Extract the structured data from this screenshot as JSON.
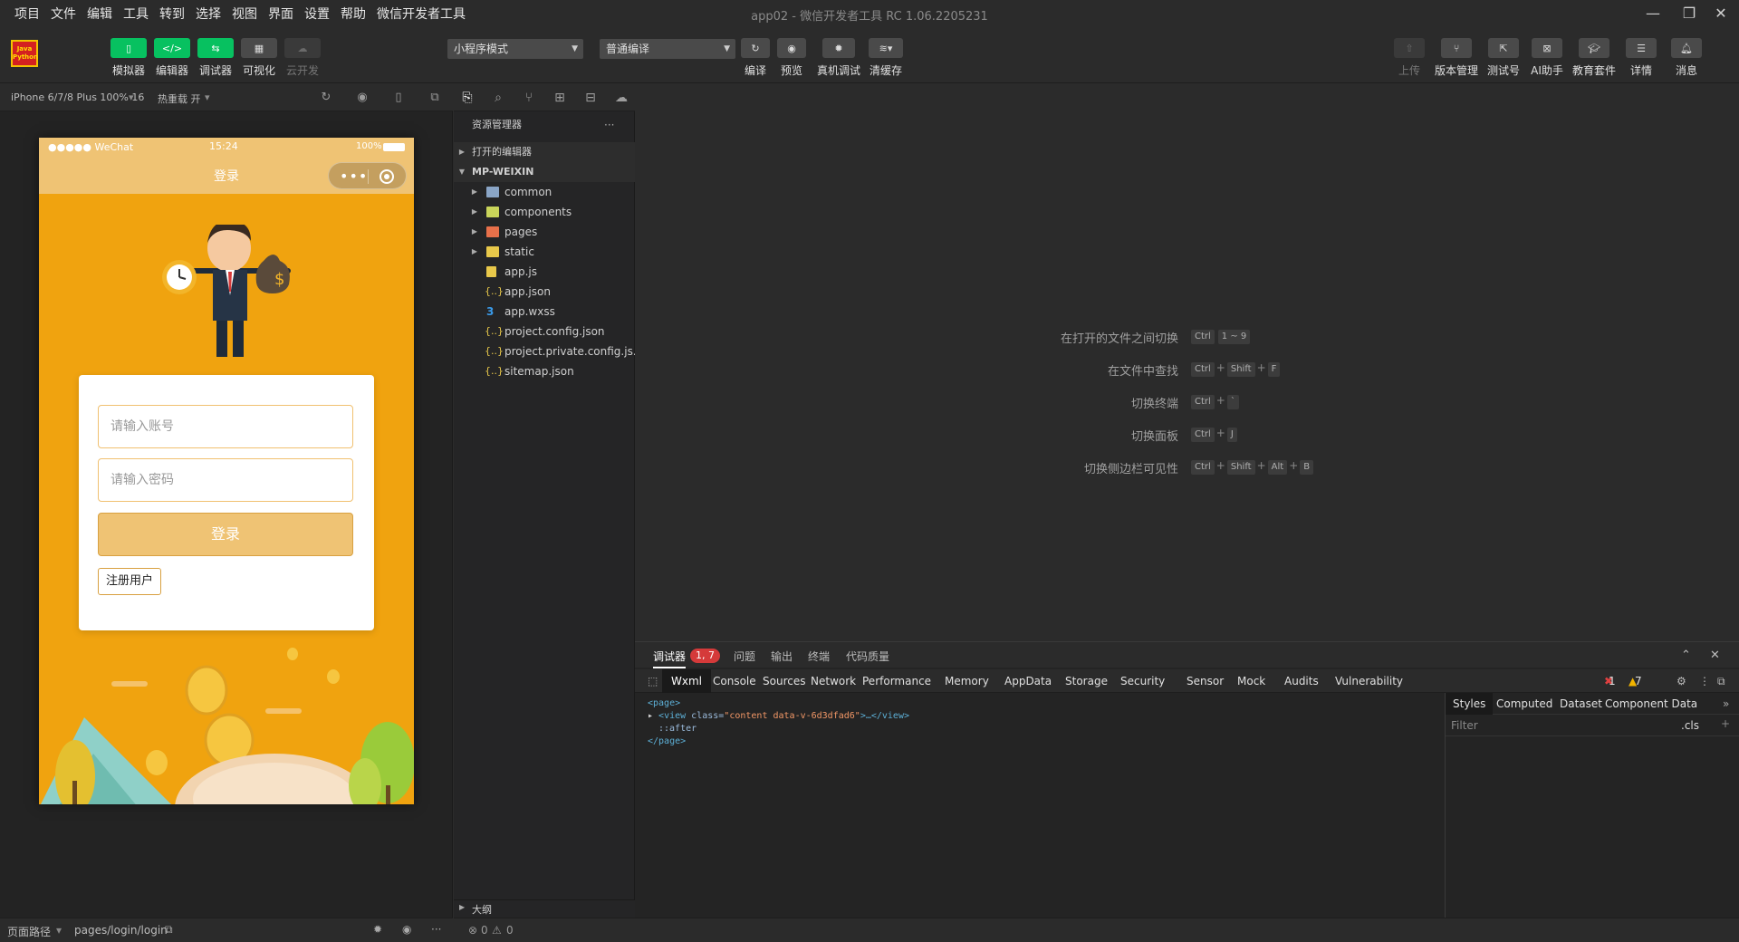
{
  "menu": [
    "项目",
    "文件",
    "编辑",
    "工具",
    "转到",
    "选择",
    "视图",
    "界面",
    "设置",
    "帮助",
    "微信开发者工具"
  ],
  "window_title": "app02 - 微信开发者工具 RC 1.06.2205231",
  "logo_text": [
    "Java",
    "Python"
  ],
  "toolbar": {
    "simulator": "模拟器",
    "editor": "编辑器",
    "debugger": "调试器",
    "visual": "可视化",
    "cloud": "云开发",
    "mode_select": "小程序模式",
    "compile_select": "普通编译",
    "compile": "编译",
    "preview": "预览",
    "real_debug": "真机调试",
    "clear_cache": "清缓存",
    "upload": "上传",
    "version": "版本管理",
    "test_account": "测试号",
    "ai": "AI助手",
    "edu": "教育套件",
    "details": "详情",
    "messages": "消息"
  },
  "device_bar": {
    "device": "iPhone 6/7/8 Plus 100% 16",
    "hot_reload": "热重载 开"
  },
  "phone": {
    "signal": "●●●●● WeChat",
    "time": "15:24",
    "battery": "100%",
    "title": "登录",
    "account_placeholder": "请输入账号",
    "password_placeholder": "请输入密码",
    "login_btn": "登录",
    "register_btn": "注册用户"
  },
  "explorer": {
    "title": "资源管理器",
    "open_editors": "打开的编辑器",
    "project": "MP-WEIXIN",
    "items": [
      {
        "name": "common",
        "type": "folder"
      },
      {
        "name": "components",
        "type": "folder"
      },
      {
        "name": "pages",
        "type": "folder"
      },
      {
        "name": "static",
        "type": "folder"
      },
      {
        "name": "app.js",
        "type": "js"
      },
      {
        "name": "app.json",
        "type": "json"
      },
      {
        "name": "app.wxss",
        "type": "css"
      },
      {
        "name": "project.config.json",
        "type": "json"
      },
      {
        "name": "project.private.config.js...",
        "type": "json"
      },
      {
        "name": "sitemap.json",
        "type": "json"
      }
    ],
    "outline": "大纲"
  },
  "shortcuts": [
    {
      "label": "在打开的文件之间切换",
      "keys": [
        "Ctrl",
        "1 ~ 9"
      ]
    },
    {
      "label": "在文件中查找",
      "keys": [
        "Ctrl",
        "+",
        "Shift",
        "+",
        "F"
      ]
    },
    {
      "label": "切换终端",
      "keys": [
        "Ctrl",
        "+",
        "`"
      ]
    },
    {
      "label": "切换面板",
      "keys": [
        "Ctrl",
        "+",
        "J"
      ]
    },
    {
      "label": "切换侧边栏可见性",
      "keys": [
        "Ctrl",
        "+",
        "Shift",
        "+",
        "Alt",
        "+",
        "B"
      ]
    }
  ],
  "debugger": {
    "tabs": [
      "调试器",
      "问题",
      "输出",
      "终端",
      "代码质量"
    ],
    "badge": "1, 7",
    "panels": [
      "Wxml",
      "Console",
      "Sources",
      "Network",
      "Performance",
      "Memory",
      "AppData",
      "Storage",
      "Security",
      "Sensor",
      "Mock",
      "Audits",
      "Vulnerability"
    ],
    "errors": "1",
    "warnings": "7",
    "styles_tabs": [
      "Styles",
      "Computed",
      "Dataset",
      "Component Data"
    ],
    "filter_placeholder": "Filter",
    "cls": ".cls",
    "code": {
      "l1": "<page>",
      "l2_tag": "<view ",
      "l2_attr": "class=",
      "l2_val": "\"content data-v-6d3dfad6\"",
      "l2_end": ">…</view>",
      "l3": "::after",
      "l4": "</page>"
    }
  },
  "status": {
    "path_label": "页面路径",
    "path": "pages/login/login",
    "errors": "0",
    "warnings": "0"
  }
}
